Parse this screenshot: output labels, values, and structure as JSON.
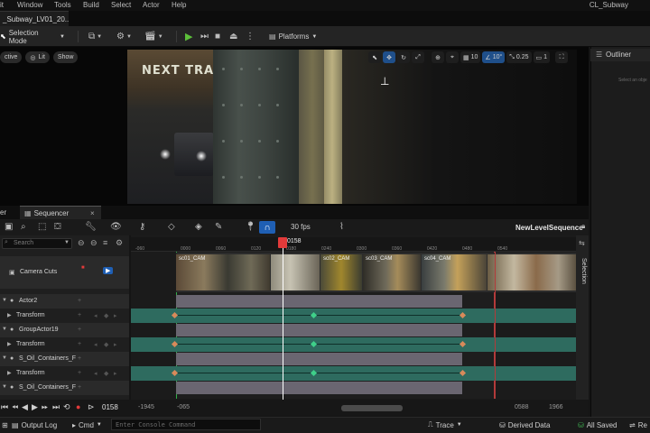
{
  "menu": {
    "items": [
      "it",
      "Window",
      "Tools",
      "Build",
      "Select",
      "Actor",
      "Help"
    ],
    "map_title": "CL_Subway"
  },
  "tab": {
    "doc_title": "_Subway_LV01_20..."
  },
  "toolbar": {
    "selection_mode": "Selection Mode",
    "platforms": "Platforms"
  },
  "viewport": {
    "perspective": "ctive",
    "lit": "Lit",
    "show": "Show",
    "sign_text": "NEXT TRA",
    "grid_snap": "10",
    "angle_snap": "10°",
    "scale_snap": "0.25",
    "camera_speed": "1"
  },
  "outliner": {
    "title": "Outliner",
    "hint": "Select an obje"
  },
  "sequencer": {
    "tabs": [
      "er",
      "Sequencer"
    ],
    "fps": "30 fps",
    "sequence_name": "NewLevelSequence",
    "search_placeholder": "Search",
    "selection_label": "Selection",
    "playhead_frame": "0158",
    "ruler_ticks": [
      "-060",
      "0000",
      "0060",
      "0120",
      "0180",
      "0240",
      "0300",
      "0360",
      "0420",
      "0480",
      "0540"
    ],
    "tracks": [
      {
        "label": "Camera Cuts",
        "kind": "camera"
      },
      {
        "label": "Actor2",
        "kind": "group"
      },
      {
        "label": "Transform",
        "kind": "track"
      },
      {
        "label": "GroupActor19",
        "kind": "group"
      },
      {
        "label": "Transform",
        "kind": "track"
      },
      {
        "label": "S_Oil_Containers_F",
        "kind": "group"
      },
      {
        "label": "Transform",
        "kind": "track"
      },
      {
        "label": "S_Oil_Containers_F",
        "kind": "group"
      }
    ],
    "shots": [
      "sc01_CAM",
      "sc02_CAM",
      "sc03_CAM",
      "sc04_CAM"
    ],
    "transport": {
      "frame": "0158",
      "range_start": "-1945",
      "view_start": "-065",
      "view_end": "0588",
      "range_end": "1966"
    }
  },
  "statusbar": {
    "output_log": "Output Log",
    "cmd": "Cmd",
    "console_placeholder": "Enter Console Command",
    "trace": "Trace",
    "derived_data": "Derived Data",
    "all_saved": "All Saved",
    "revision": "Re"
  },
  "colors": {
    "accent": "#1f5fb4",
    "play_green": "#5cbf3a",
    "track_teal": "#2e6b5f",
    "playhead": "#e23a3a"
  }
}
